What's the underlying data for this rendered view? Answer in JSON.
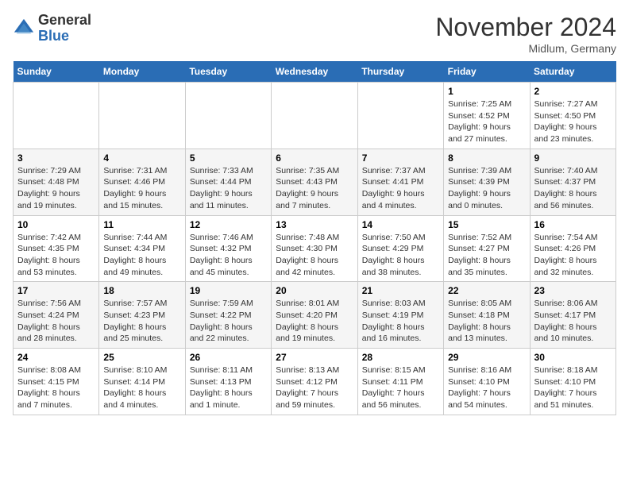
{
  "header": {
    "logo_general": "General",
    "logo_blue": "Blue",
    "month_title": "November 2024",
    "subtitle": "Midlum, Germany"
  },
  "weekdays": [
    "Sunday",
    "Monday",
    "Tuesday",
    "Wednesday",
    "Thursday",
    "Friday",
    "Saturday"
  ],
  "weeks": [
    [
      {
        "day": "",
        "info": ""
      },
      {
        "day": "",
        "info": ""
      },
      {
        "day": "",
        "info": ""
      },
      {
        "day": "",
        "info": ""
      },
      {
        "day": "",
        "info": ""
      },
      {
        "day": "1",
        "info": "Sunrise: 7:25 AM\nSunset: 4:52 PM\nDaylight: 9 hours and 27 minutes."
      },
      {
        "day": "2",
        "info": "Sunrise: 7:27 AM\nSunset: 4:50 PM\nDaylight: 9 hours and 23 minutes."
      }
    ],
    [
      {
        "day": "3",
        "info": "Sunrise: 7:29 AM\nSunset: 4:48 PM\nDaylight: 9 hours and 19 minutes."
      },
      {
        "day": "4",
        "info": "Sunrise: 7:31 AM\nSunset: 4:46 PM\nDaylight: 9 hours and 15 minutes."
      },
      {
        "day": "5",
        "info": "Sunrise: 7:33 AM\nSunset: 4:44 PM\nDaylight: 9 hours and 11 minutes."
      },
      {
        "day": "6",
        "info": "Sunrise: 7:35 AM\nSunset: 4:43 PM\nDaylight: 9 hours and 7 minutes."
      },
      {
        "day": "7",
        "info": "Sunrise: 7:37 AM\nSunset: 4:41 PM\nDaylight: 9 hours and 4 minutes."
      },
      {
        "day": "8",
        "info": "Sunrise: 7:39 AM\nSunset: 4:39 PM\nDaylight: 9 hours and 0 minutes."
      },
      {
        "day": "9",
        "info": "Sunrise: 7:40 AM\nSunset: 4:37 PM\nDaylight: 8 hours and 56 minutes."
      }
    ],
    [
      {
        "day": "10",
        "info": "Sunrise: 7:42 AM\nSunset: 4:35 PM\nDaylight: 8 hours and 53 minutes."
      },
      {
        "day": "11",
        "info": "Sunrise: 7:44 AM\nSunset: 4:34 PM\nDaylight: 8 hours and 49 minutes."
      },
      {
        "day": "12",
        "info": "Sunrise: 7:46 AM\nSunset: 4:32 PM\nDaylight: 8 hours and 45 minutes."
      },
      {
        "day": "13",
        "info": "Sunrise: 7:48 AM\nSunset: 4:30 PM\nDaylight: 8 hours and 42 minutes."
      },
      {
        "day": "14",
        "info": "Sunrise: 7:50 AM\nSunset: 4:29 PM\nDaylight: 8 hours and 38 minutes."
      },
      {
        "day": "15",
        "info": "Sunrise: 7:52 AM\nSunset: 4:27 PM\nDaylight: 8 hours and 35 minutes."
      },
      {
        "day": "16",
        "info": "Sunrise: 7:54 AM\nSunset: 4:26 PM\nDaylight: 8 hours and 32 minutes."
      }
    ],
    [
      {
        "day": "17",
        "info": "Sunrise: 7:56 AM\nSunset: 4:24 PM\nDaylight: 8 hours and 28 minutes."
      },
      {
        "day": "18",
        "info": "Sunrise: 7:57 AM\nSunset: 4:23 PM\nDaylight: 8 hours and 25 minutes."
      },
      {
        "day": "19",
        "info": "Sunrise: 7:59 AM\nSunset: 4:22 PM\nDaylight: 8 hours and 22 minutes."
      },
      {
        "day": "20",
        "info": "Sunrise: 8:01 AM\nSunset: 4:20 PM\nDaylight: 8 hours and 19 minutes."
      },
      {
        "day": "21",
        "info": "Sunrise: 8:03 AM\nSunset: 4:19 PM\nDaylight: 8 hours and 16 minutes."
      },
      {
        "day": "22",
        "info": "Sunrise: 8:05 AM\nSunset: 4:18 PM\nDaylight: 8 hours and 13 minutes."
      },
      {
        "day": "23",
        "info": "Sunrise: 8:06 AM\nSunset: 4:17 PM\nDaylight: 8 hours and 10 minutes."
      }
    ],
    [
      {
        "day": "24",
        "info": "Sunrise: 8:08 AM\nSunset: 4:15 PM\nDaylight: 8 hours and 7 minutes."
      },
      {
        "day": "25",
        "info": "Sunrise: 8:10 AM\nSunset: 4:14 PM\nDaylight: 8 hours and 4 minutes."
      },
      {
        "day": "26",
        "info": "Sunrise: 8:11 AM\nSunset: 4:13 PM\nDaylight: 8 hours and 1 minute."
      },
      {
        "day": "27",
        "info": "Sunrise: 8:13 AM\nSunset: 4:12 PM\nDaylight: 7 hours and 59 minutes."
      },
      {
        "day": "28",
        "info": "Sunrise: 8:15 AM\nSunset: 4:11 PM\nDaylight: 7 hours and 56 minutes."
      },
      {
        "day": "29",
        "info": "Sunrise: 8:16 AM\nSunset: 4:10 PM\nDaylight: 7 hours and 54 minutes."
      },
      {
        "day": "30",
        "info": "Sunrise: 8:18 AM\nSunset: 4:10 PM\nDaylight: 7 hours and 51 minutes."
      }
    ]
  ]
}
